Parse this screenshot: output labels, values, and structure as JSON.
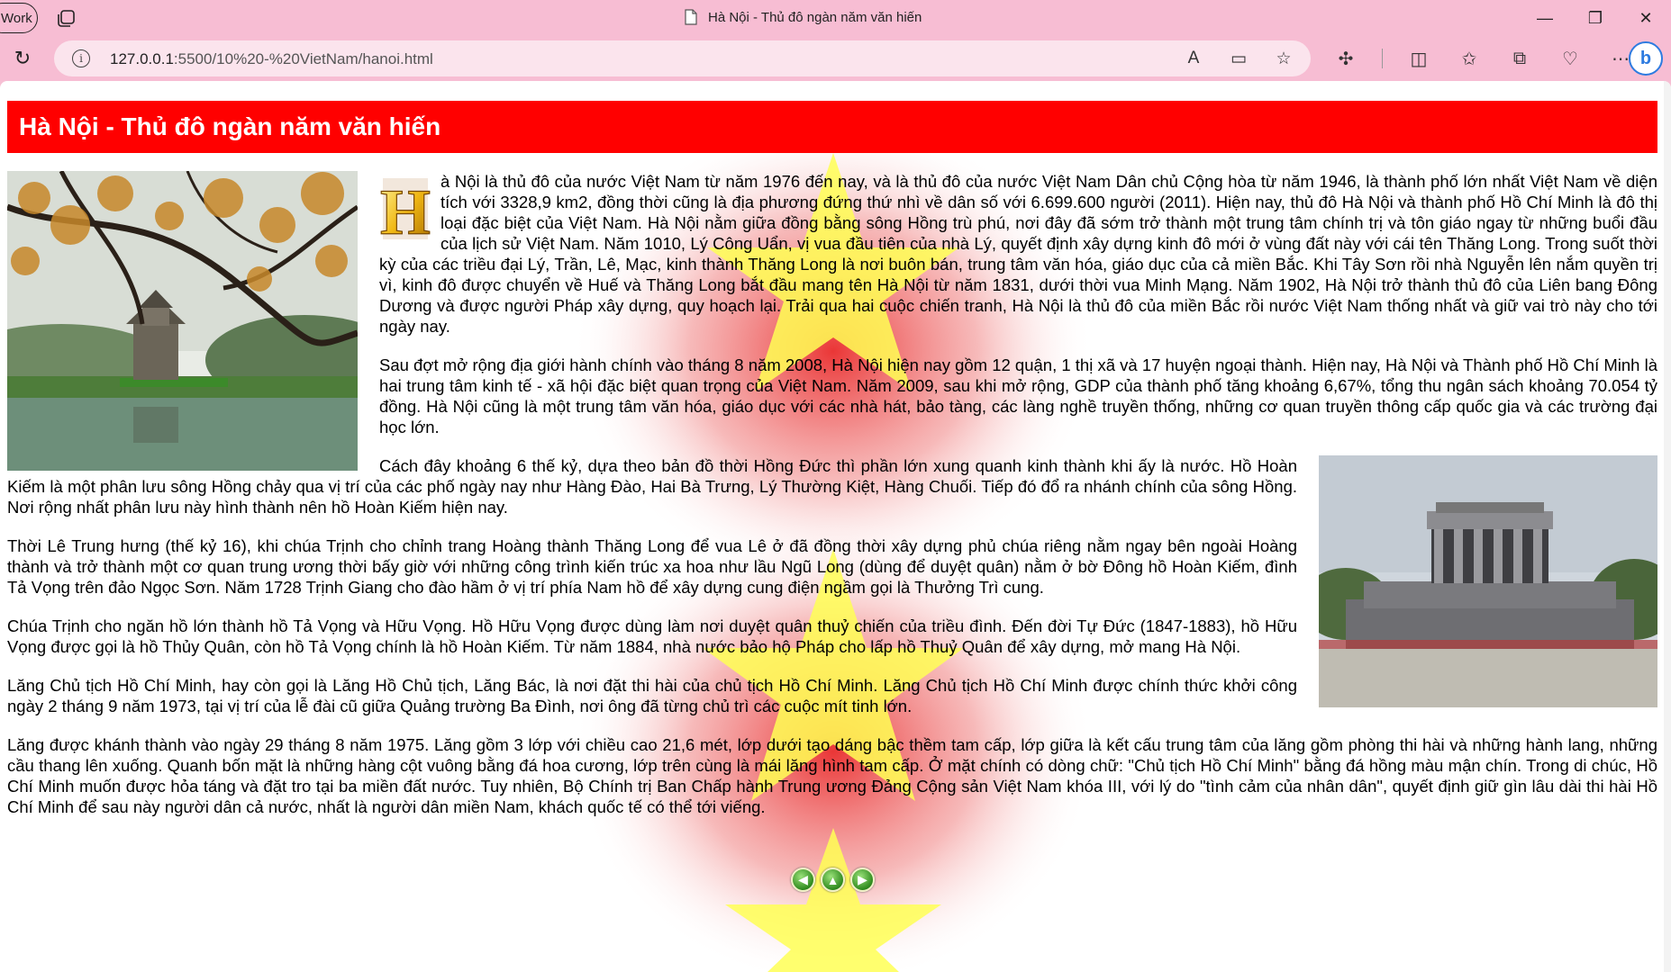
{
  "browser": {
    "profile_label": "Work",
    "window_title": "Hà Nội - Thủ đô ngàn năm văn hiến",
    "url_host": "127.0.0.1",
    "url_rest": ":5500/10%20-%20VietNam/hanoi.html",
    "controls": {
      "minimize": "—",
      "restore": "❐",
      "close": "✕"
    }
  },
  "page": {
    "header_title": "Hà Nội - Thủ đô ngàn năm văn hiến",
    "dropcap_letter": "H",
    "paragraphs": [
      "à Nội là thủ đô của nước Việt Nam từ năm 1976 đến nay, và là thủ đô của nước Việt Nam Dân chủ Cộng hòa từ năm 1946, là thành phố lớn nhất Việt Nam về diện tích với 3328,9 km2, đồng thời cũng là địa phương đứng thứ nhì về dân số với 6.699.600 người (2011). Hiện nay, thủ đô Hà Nội và thành phố Hồ Chí Minh là đô thị loại đặc biệt của Việt Nam. Hà Nội nằm giữa đồng bằng sông Hồng trù phú, nơi đây đã sớm trở thành một trung tâm chính trị và tôn giáo ngay từ những buổi đầu của lịch sử Việt Nam. Năm 1010, Lý Công Uẩn, vị vua đầu tiên của nhà Lý, quyết định xây dựng kinh đô mới ở vùng đất này với cái tên Thăng Long. Trong suốt thời kỳ của các triều đại Lý, Trần, Lê, Mạc, kinh thành Thăng Long là nơi buôn bán, trung tâm văn hóa, giáo dục của cả miền Bắc. Khi Tây Sơn rồi nhà Nguyễn lên nắm quyền trị vì, kinh đô được chuyển về Huế và Thăng Long bắt đầu mang tên Hà Nội từ năm 1831, dưới thời vua Minh Mạng. Năm 1902, Hà Nội trở thành thủ đô của Liên bang Đông Dương và được người Pháp xây dựng, quy hoạch lại. Trải qua hai cuộc chiến tranh, Hà Nội là thủ đô của miền Bắc rồi nước Việt Nam thống nhất và giữ vai trò này cho tới ngày nay.",
      "Sau đợt mở rộng địa giới hành chính vào tháng 8 năm 2008, Hà Nội hiện nay gồm 12 quận, 1 thị xã và 17 huyện ngoại thành. Hiện nay, Hà Nội và Thành phố Hồ Chí Minh là hai trung tâm kinh tế - xã hội đặc biệt quan trọng của Việt Nam. Năm 2009, sau khi mở rộng, GDP của thành phố tăng khoảng 6,67%, tổng thu ngân sách khoảng 70.054 tỷ đồng. Hà Nội cũng là một trung tâm văn hóa, giáo dục với các nhà hát, bảo tàng, các làng nghề truyền thống, những cơ quan truyền thông cấp quốc gia và các trường đại học lớn.",
      "Cách đây khoảng 6 thế kỷ, dựa theo bản đồ thời Hồng Đức thì phần lớn xung quanh kinh thành khi ấy là nước. Hồ Hoàn Kiếm là một phân lưu sông Hồng chảy qua vị trí của các phố ngày nay như Hàng Đào, Hai Bà Trưng, Lý Thường Kiệt, Hàng Chuối. Tiếp đó đổ ra nhánh chính của sông Hồng. Nơi rộng nhất phân lưu này hình thành nên hồ Hoàn Kiếm hiện nay.",
      "Thời Lê Trung hưng (thế kỷ 16), khi chúa Trịnh cho chỉnh trang Hoàng thành Thăng Long để vua Lê ở đã đồng thời xây dựng phủ chúa riêng nằm ngay bên ngoài Hoàng thành và trở thành một cơ quan trung ương thời bấy giờ với những công trình kiến trúc xa hoa như lầu Ngũ Long (dùng để duyệt quân) nằm ở bờ Đông hồ Hoàn Kiếm, đình Tả Vọng trên đảo Ngọc Sơn. Năm 1728 Trịnh Giang cho đào hầm ở vị trí phía Nam hồ để xây dựng cung điện ngầm gọi là Thưởng Trì cung.",
      "Chúa Trịnh cho ngăn hồ lớn thành hồ Tả Vọng và Hữu Vọng. Hồ Hữu Vọng được dùng làm nơi duyệt quân thuỷ chiến của triều đình. Đến đời Tự Đức (1847-1883), hồ Hữu Vọng được gọi là hồ Thủy Quân, còn hồ Tả Vọng chính là hồ Hoàn Kiếm. Từ năm 1884, nhà nước bảo hộ Pháp cho lấp hồ Thuỷ Quân để xây dựng, mở mang Hà Nội.",
      "Lăng Chủ tịch Hồ Chí Minh, hay còn gọi là Lăng Hồ Chủ tịch, Lăng Bác, là nơi đặt thi hài của chủ tịch Hồ Chí Minh. Lăng Chủ tịch Hồ Chí Minh được chính thức khởi công ngày 2 tháng 9 năm 1973, tại vị trí của lễ đài cũ giữa Quảng trường Ba Đình, nơi ông đã từng chủ trì các cuộc mít tinh lớn.",
      "Lăng được khánh thành vào ngày 29 tháng 8 năm 1975. Lăng gồm 3 lớp với chiều cao 21,6 mét, lớp dưới tạo dáng bậc thềm tam cấp, lớp giữa là kết cấu trung tâm của lăng gồm phòng thi hài và những hành lang, những cầu thang lên xuống. Quanh bốn mặt là những hàng cột vuông bằng đá hoa cương, lớp trên cùng là mái lăng hình tam cấp. Ở mặt chính có dòng chữ: \"Chủ tịch Hồ Chí Minh\" bằng đá hồng màu mận chín. Trong di chúc, Hồ Chí Minh muốn được hỏa táng và đặt tro tại ba miền đất nước. Tuy nhiên, Bộ Chính trị Ban Chấp hành Trung ương Đảng Cộng sản Việt Nam khóa III, với lý do \"tình cảm của nhân dân\", quyết định giữ gìn lâu dài thi hài Hồ Chí Minh để sau này người dân cả nước, nhất là người dân miền Nam, khách quốc tế có thể tới viếng."
    ],
    "nav": {
      "prev": "◀",
      "up": "▲",
      "next": "▶"
    }
  }
}
